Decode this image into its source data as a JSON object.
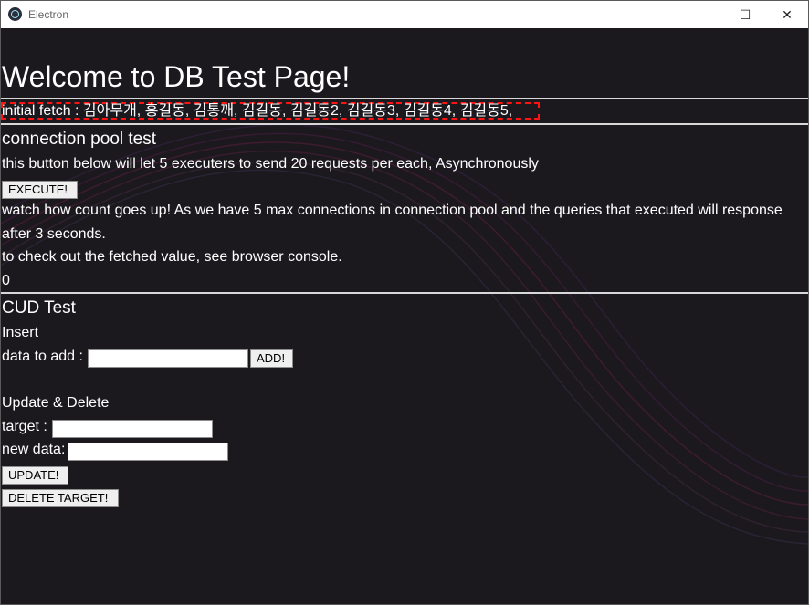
{
  "window": {
    "title": "Electron",
    "controls": {
      "minimize": "—",
      "maximize": "☐",
      "close": "✕"
    }
  },
  "page": {
    "title": "Welcome to DB Test Page!",
    "initial_fetch": "initial fetch : 김아무개, 홍길동, 김통깨, 김길동, 김길동2, 김길동3, 김길동4, 김길동5,",
    "connection_pool": {
      "heading": "connection pool test",
      "description": "this button below will let 5 executers to send 20 requests per each, Asynchronously",
      "execute_label": "EXECUTE!",
      "info_line1": "watch how count goes up! As we have 5 max connections in connection pool and the queries that executed will response",
      "info_line2": "after 3 seconds.",
      "info_line3": "to check out the fetched value, see browser console.",
      "count": "0"
    },
    "cud": {
      "heading": "CUD Test",
      "insert_label": "Insert",
      "data_to_add_label": "data to add :",
      "data_to_add_value": "",
      "add_label": "ADD!",
      "update_delete_label": "Update & Delete",
      "target_label": "target :",
      "target_value": "",
      "new_data_label": "new data:",
      "new_data_value": "",
      "update_label": "UPDATE!",
      "delete_label": "DELETE TARGET!"
    }
  },
  "colors": {
    "background": "#1b191e",
    "text": "#ffffff",
    "focus_outline": "#ff1313",
    "divider": "#d8d8d8"
  },
  "icons": {
    "app": "electron-icon",
    "minimize": "minimize-icon",
    "maximize": "maximize-icon",
    "close": "close-icon"
  }
}
